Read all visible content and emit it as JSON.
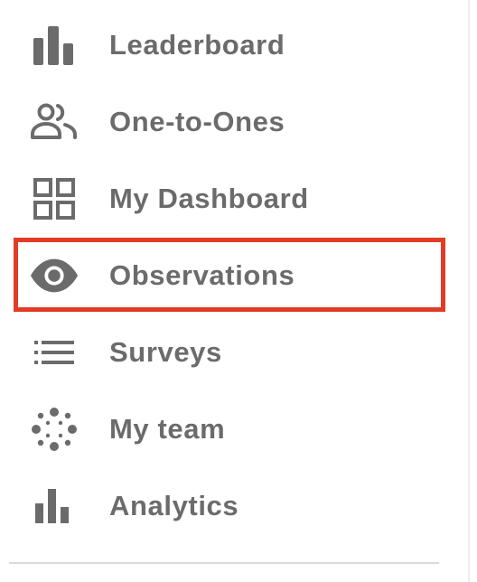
{
  "sidebar": {
    "items": [
      {
        "label": "Leaderboard",
        "icon": "leaderboard-bar-chart-icon"
      },
      {
        "label": "One-to-Ones",
        "icon": "people-icon"
      },
      {
        "label": "My Dashboard",
        "icon": "dashboard-grid-icon"
      },
      {
        "label": "Observations",
        "icon": "eye-icon",
        "highlighted": true
      },
      {
        "label": "Surveys",
        "icon": "list-icon"
      },
      {
        "label": "My team",
        "icon": "team-dots-icon"
      },
      {
        "label": "Analytics",
        "icon": "analytics-bar-chart-icon"
      }
    ]
  },
  "colors": {
    "text": "#6b6b6b",
    "icon": "#6b6b6b",
    "highlight_border": "#e23c25",
    "background": "#ffffff"
  }
}
